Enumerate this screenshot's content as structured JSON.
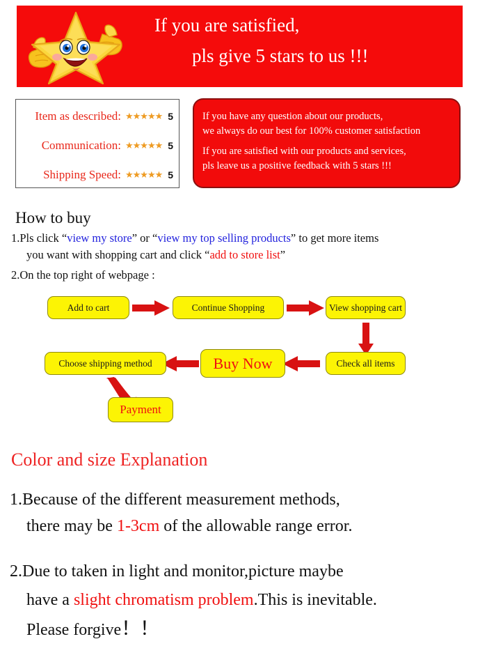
{
  "banner": {
    "line1": "If you are satisfied,",
    "line2": "pls give 5 stars to us !!!",
    "bg_color": "#F50B0B",
    "text_color": "#FFFFFF",
    "mascot": "star-thumbs-up-mascot"
  },
  "ratings": {
    "rows": [
      {
        "label": "Item as described:",
        "stars": "★★★★★",
        "value": "5"
      },
      {
        "label": "Communication:",
        "stars": "★★★★★",
        "value": "5"
      },
      {
        "label": "Shipping Speed:",
        "stars": "★★★★★",
        "value": "5"
      }
    ],
    "star_color": "#EE9B22",
    "label_color": "#E8271A"
  },
  "feedback": {
    "line1": "If you have any question about our products,",
    "line2": "we always do our best for 100% customer satisfaction",
    "line3": "If you are satisfied with our products and services,",
    "line4": "pls leave us a positive feedback with 5 stars !!!",
    "bg_color": "#F20B0B"
  },
  "howto": {
    "title": "How to buy",
    "item1_a": "1.Pls click “",
    "item1_link1": "view my store",
    "item1_b": "” or “",
    "item1_link2": "view my top selling products",
    "item1_c": "” to get more items",
    "item1_d": "you want with shopping cart and click “",
    "item1_red": "add to store list",
    "item1_e": "”",
    "item2": "2.On the top right of webpage :"
  },
  "flow": {
    "boxes": [
      {
        "id": "add-to-cart",
        "label": "Add to cart"
      },
      {
        "id": "continue-shopping",
        "label": "Continue Shopping"
      },
      {
        "id": "view-shopping-cart",
        "label": "View shopping cart"
      },
      {
        "id": "check-all-items",
        "label": "Check all items"
      },
      {
        "id": "buy-now",
        "label": "Buy Now"
      },
      {
        "id": "choose-shipping-method",
        "label": "Choose shipping method"
      },
      {
        "id": "payment",
        "label": "Payment"
      }
    ],
    "box_color": "#FCF404",
    "arrow_color": "#D81212"
  },
  "colorsize": {
    "title": "Color and size Explanation",
    "item1_a": "1.Because of the different measurement methods,",
    "item1_b": "there may be ",
    "item1_red": "1-3cm",
    "item1_c": " of the allowable range error.",
    "item2_a": "2.Due to taken in light and monitor,picture maybe",
    "item2_b": "have a ",
    "item2_red": "slight chromatism problem",
    "item2_c": ".This is inevitable.",
    "item2_d": "Please forgive",
    "item2_bang": "！！",
    "title_color": "#EE2222"
  }
}
